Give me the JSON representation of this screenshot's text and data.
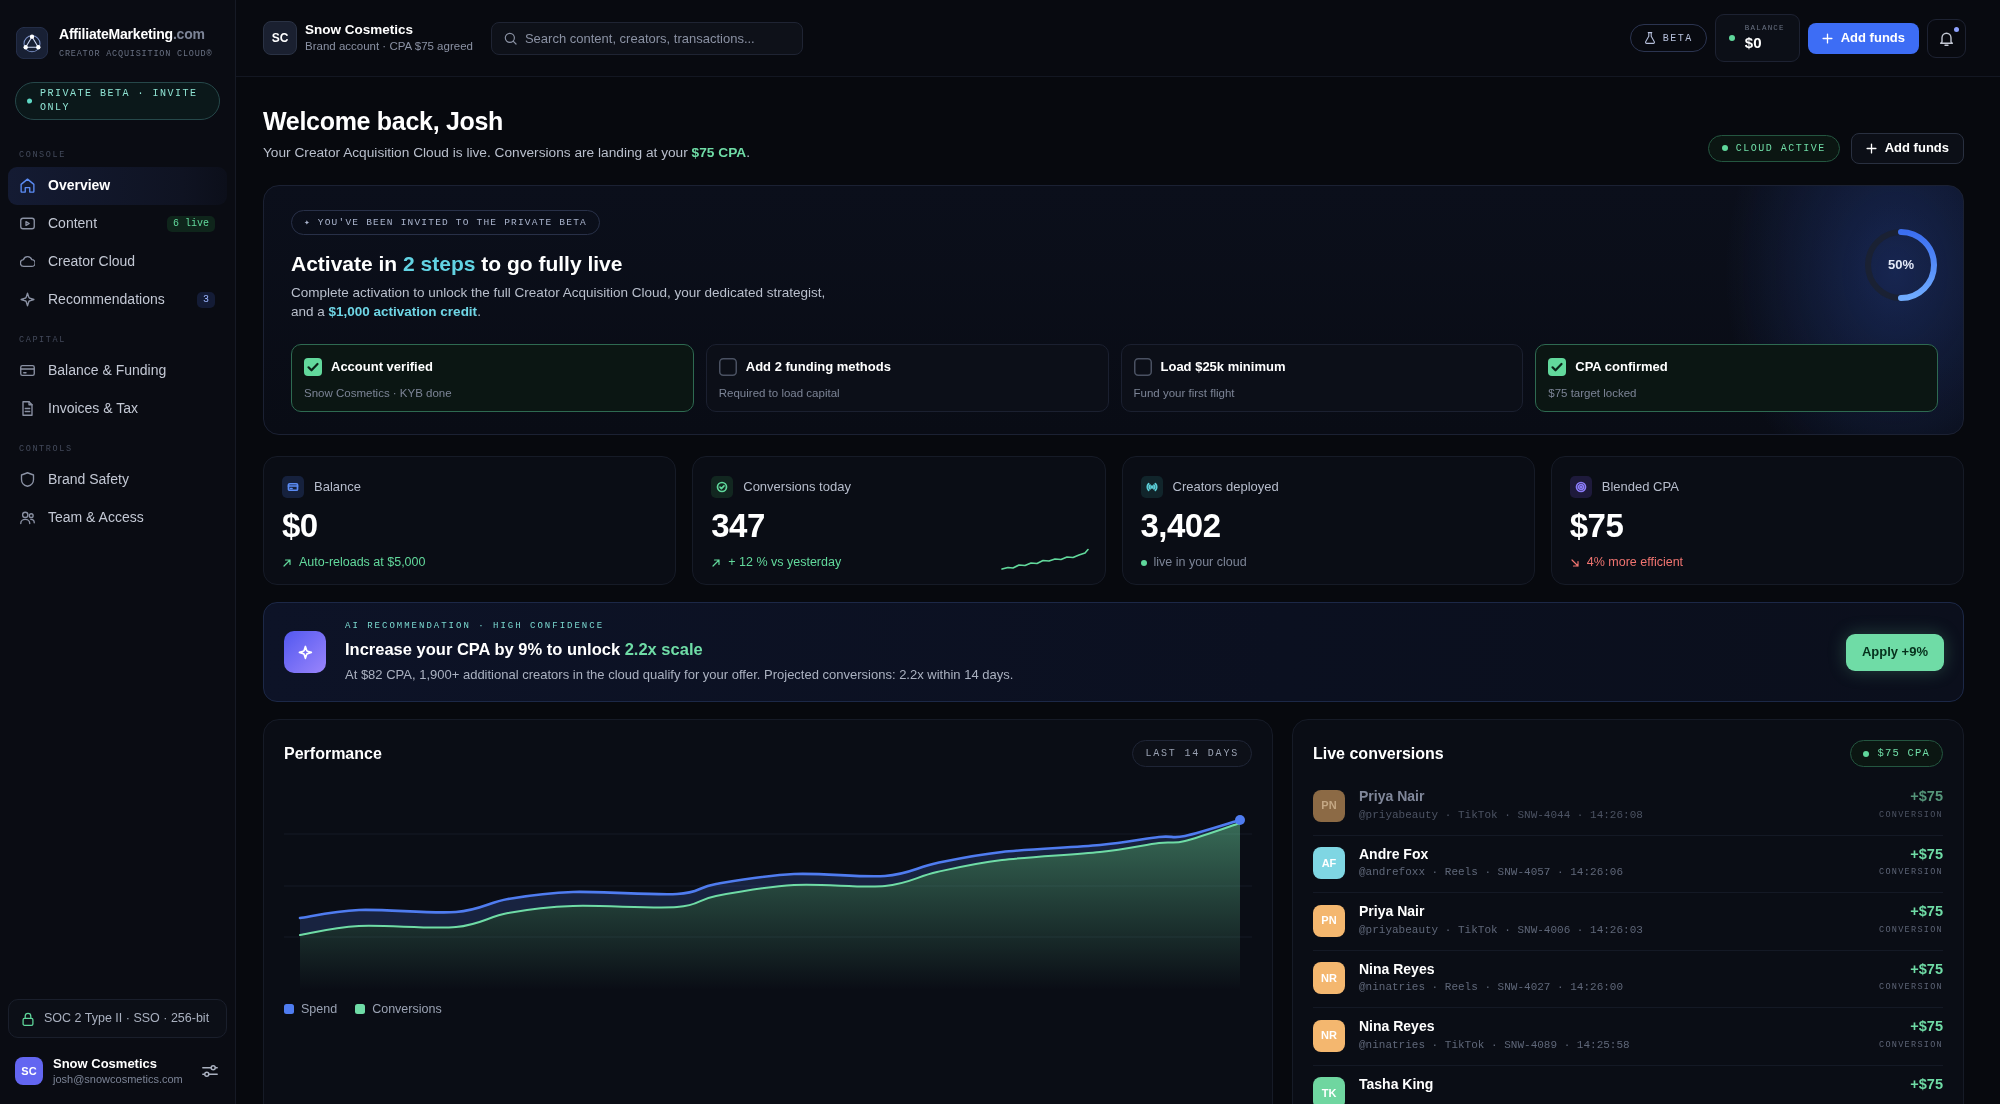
{
  "sidebar": {
    "brand": {
      "name": "AffiliateMarketing",
      "suffix": ".com",
      "tagline": "CREATOR ACQUISITION CLOUD®"
    },
    "beta_pill": "PRIVATE BETA · INVITE ONLY",
    "sections": [
      {
        "label": "CONSOLE",
        "items": [
          {
            "label": "Overview",
            "selected": true
          },
          {
            "label": "Content",
            "selected": false,
            "badge": {
              "text": "6 live",
              "kind": "live"
            }
          },
          {
            "label": "Creator Cloud",
            "selected": false
          },
          {
            "label": "Recommendations",
            "selected": false,
            "badge": {
              "text": "3",
              "kind": "count"
            }
          }
        ]
      },
      {
        "label": "CAPITAL",
        "items": [
          {
            "label": "Balance & Funding",
            "selected": false
          },
          {
            "label": "Invoices & Tax",
            "selected": false
          }
        ]
      },
      {
        "label": "CONTROLS",
        "items": [
          {
            "label": "Brand Safety",
            "selected": false
          },
          {
            "label": "Team & Access",
            "selected": false
          }
        ]
      }
    ],
    "security_note": "SOC 2 Type II · SSO · 256-bit",
    "account": {
      "initials": "SC",
      "name": "Snow Cosmetics",
      "email": "josh@snowcosmetics.com"
    }
  },
  "top_bar": {
    "account": {
      "initials": "SC",
      "name": "Snow Cosmetics",
      "subtitle": "Brand account · CPA $75 agreed"
    },
    "search": {
      "placeholder": "Search content, creators, transactions..."
    },
    "beta_badge": "BETA",
    "balance": {
      "label": "BALANCE",
      "value": "$0"
    },
    "add_funds": "Add funds"
  },
  "welcome": {
    "title": "Welcome back, Josh",
    "subtitle": "Your Creator Acquisition Cloud is live. Conversions are landing at your **$75 CPA**.",
    "status": "CLOUD ACTIVE",
    "add_funds": "Add funds"
  },
  "activation": {
    "invite": "✦ YOU'VE BEEN INVITED TO THE PRIVATE BETA",
    "title": "Activate in **2 steps** to go fully live",
    "description": "Complete activation to unlock the full Creator Acquisition Cloud, your dedicated strategist, and a **$1,000 activation credit**.",
    "progress": {
      "label": "50%",
      "level": 0.5
    },
    "steps": [
      {
        "title": "Account verified",
        "subtitle": "Snow Cosmetics · KYB done",
        "checked": true
      },
      {
        "title": "Add 2 funding methods",
        "subtitle": "Required to load capital",
        "checked": false
      },
      {
        "title": "Load $25k minimum",
        "subtitle": "Fund your first flight",
        "checked": false
      },
      {
        "title": "CPA confirmed",
        "subtitle": "$75 target locked",
        "checked": true
      }
    ]
  },
  "stats": [
    {
      "label": "Balance",
      "value": "$0",
      "trend": "Auto-reloads at $5,000",
      "kind": "up",
      "sparkline": false
    },
    {
      "label": "Conversions today",
      "value": "347",
      "trend": "+ 12 % vs yesterday",
      "kind": "up",
      "sparkline": true
    },
    {
      "label": "Creators deployed",
      "value": "3,402",
      "trend": "live in your cloud",
      "kind": "live",
      "sparkline": false
    },
    {
      "label": "Blended CPA",
      "value": "$75",
      "trend": "4% more efficient",
      "kind": "down",
      "sparkline": false
    }
  ],
  "recommendation": {
    "label": "AI RECOMMENDATION · HIGH CONFIDENCE",
    "title": "Increase your CPA by 9% to unlock **2.2x scale**",
    "description": "At $82 CPA, 1,900+ additional creators in the cloud qualify for your offer. Projected conversions: 2.2x within 14 days.",
    "button": "Apply +9%"
  },
  "performance": {
    "title": "Performance",
    "range": "LAST 14 DAYS",
    "legend": [
      {
        "label": "Spend",
        "color": "#4f7cf0"
      },
      {
        "label": "Conversions",
        "color": "#6fdca6"
      }
    ]
  },
  "live_conversions": {
    "title": "Live conversions",
    "badge": "$75 CPA",
    "rows": [
      {
        "initials": "PN",
        "color": "#8c6a45",
        "name": "Priya Nair",
        "meta": "@priyabeauty · TikTok · SNW-4044 · 14:26:08",
        "amount": "+$75",
        "amount_label": "CONVERSION",
        "dimmed": true
      },
      {
        "initials": "AF",
        "color": "#7fd6e3",
        "name": "Andre Fox",
        "meta": "@andrefoxx · Reels · SNW-4057 · 14:26:06",
        "amount": "+$75",
        "amount_label": "CONVERSION",
        "dimmed": false
      },
      {
        "initials": "PN",
        "color": "#f4b76f",
        "name": "Priya Nair",
        "meta": "@priyabeauty · TikTok · SNW-4006 · 14:26:03",
        "amount": "+$75",
        "amount_label": "CONVERSION",
        "dimmed": false
      },
      {
        "initials": "NR",
        "color": "#f4b76f",
        "name": "Nina Reyes",
        "meta": "@ninatries · Reels · SNW-4027 · 14:26:00",
        "amount": "+$75",
        "amount_label": "CONVERSION",
        "dimmed": false
      },
      {
        "initials": "NR",
        "color": "#f4b76f",
        "name": "Nina Reyes",
        "meta": "@ninatries · TikTok · SNW-4089 · 14:25:58",
        "amount": "+$75",
        "amount_label": "CONVERSION",
        "dimmed": false
      },
      {
        "initials": "TK",
        "color": "#6fd6a0",
        "name": "Tasha King",
        "amount": "+$75",
        "dimmed": false
      }
    ]
  }
}
